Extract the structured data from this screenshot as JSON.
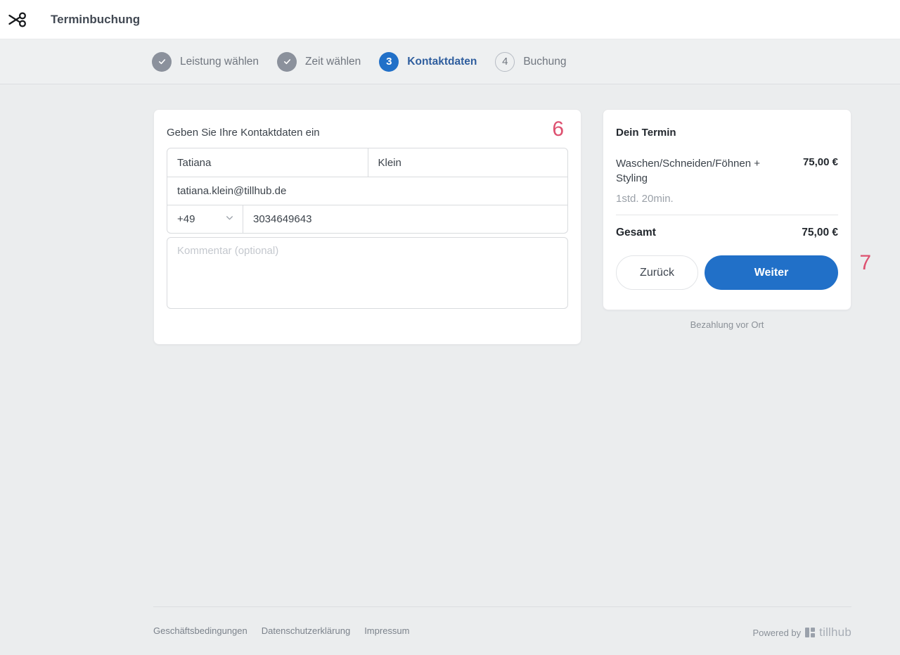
{
  "header": {
    "title": "Terminbuchung"
  },
  "stepper": {
    "steps": [
      {
        "label": "Leistung wählen",
        "state": "completed"
      },
      {
        "label": "Zeit wählen",
        "state": "completed"
      },
      {
        "label": "Kontaktdaten",
        "state": "active",
        "number": "3"
      },
      {
        "label": "Buchung",
        "state": "upcoming",
        "number": "4"
      }
    ]
  },
  "contact_form": {
    "heading": "Geben Sie Ihre Kontaktdaten ein",
    "first_name": "Tatiana",
    "last_name": "Klein",
    "email": "tatiana.klein@tillhub.de",
    "phone_country_code": "+49",
    "phone_number": "3034649643",
    "comment_placeholder": "Kommentar (optional)"
  },
  "summary": {
    "title": "Dein Termin",
    "service_name": "Waschen/Schneiden/Föhnen + Styling",
    "service_price": "75,00 €",
    "service_duration": "1std. 20min.",
    "total_label": "Gesamt",
    "total_price": "75,00 €",
    "back_button": "Zurück",
    "next_button": "Weiter",
    "payment_note": "Bezahlung vor Ort"
  },
  "annotations": {
    "form_marker": "6",
    "next_marker": "7",
    "color": "#dd5170"
  },
  "footer": {
    "links": [
      {
        "label": "Geschäftsbedingungen"
      },
      {
        "label": "Datenschutzerklärung"
      },
      {
        "label": "Impressum"
      }
    ],
    "powered_by": "Powered by",
    "brand": "tillhub"
  },
  "colors": {
    "accent_blue": "#2170c8",
    "active_label_blue": "#2f5e9e",
    "completed_step_gray": "#8b919c",
    "page_background": "#ebedee",
    "stepper_background": "#eef0f1",
    "annotation_pink": "#dd5170"
  }
}
